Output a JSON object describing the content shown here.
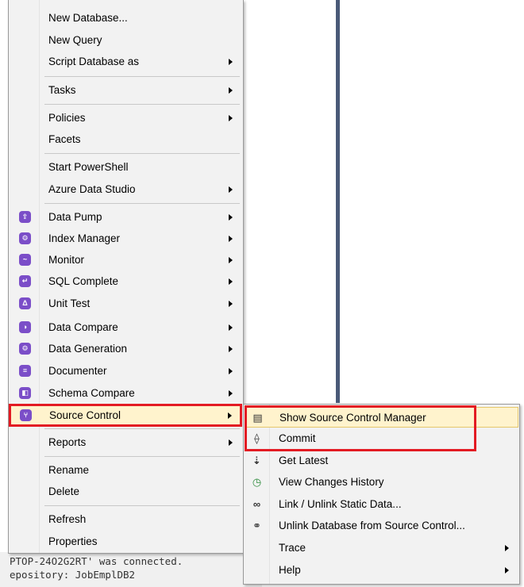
{
  "main_menu": {
    "items": [
      {
        "label": "New Database...",
        "arrow": false
      },
      {
        "label": "New Query",
        "arrow": false
      },
      {
        "label": "Script Database as",
        "arrow": true
      },
      {
        "label": "Tasks",
        "arrow": true
      },
      {
        "label": "Policies",
        "arrow": true
      },
      {
        "label": "Facets",
        "arrow": false
      },
      {
        "label": "Start PowerShell",
        "arrow": false
      },
      {
        "label": "Azure Data Studio",
        "arrow": true
      },
      {
        "label": "Data Pump",
        "arrow": true,
        "icon": "data-pump-icon"
      },
      {
        "label": "Index Manager",
        "arrow": true,
        "icon": "index-manager-icon"
      },
      {
        "label": "Monitor",
        "arrow": true,
        "icon": "monitor-icon"
      },
      {
        "label": "SQL Complete",
        "arrow": true,
        "icon": "sql-complete-icon"
      },
      {
        "label": "Unit Test",
        "arrow": true,
        "icon": "unit-test-icon"
      },
      {
        "label": "Data Compare",
        "arrow": true,
        "icon": "data-compare-icon"
      },
      {
        "label": "Data Generation",
        "arrow": true,
        "icon": "data-generation-icon"
      },
      {
        "label": "Documenter",
        "arrow": true,
        "icon": "documenter-icon"
      },
      {
        "label": "Schema Compare",
        "arrow": true,
        "icon": "schema-compare-icon"
      },
      {
        "label": "Source Control",
        "arrow": true,
        "icon": "source-control-icon",
        "highlighted": true
      },
      {
        "label": "Reports",
        "arrow": true
      },
      {
        "label": "Rename",
        "arrow": false
      },
      {
        "label": "Delete",
        "arrow": false
      },
      {
        "label": "Refresh",
        "arrow": false
      },
      {
        "label": "Properties",
        "arrow": false
      }
    ]
  },
  "sub_menu": {
    "items": [
      {
        "label": "Show Source Control Manager",
        "arrow": false,
        "icon": "source-control-manager-icon",
        "highlighted": true
      },
      {
        "label": "Commit",
        "arrow": false,
        "icon": "commit-icon"
      },
      {
        "label": "Get Latest",
        "arrow": false,
        "icon": "get-latest-icon"
      },
      {
        "label": "View Changes History",
        "arrow": false,
        "icon": "history-icon"
      },
      {
        "label": "Link / Unlink Static Data...",
        "arrow": false,
        "icon": "link-icon"
      },
      {
        "label": "Unlink Database from Source Control...",
        "arrow": false,
        "icon": "unlink-icon"
      },
      {
        "label": "Trace",
        "arrow": true
      },
      {
        "label": "Help",
        "arrow": true
      }
    ]
  },
  "status": {
    "line1": "PTOP-24O2G2RT' was connected.",
    "line2": "epository: JobEmplDB2"
  },
  "colors": {
    "accent_icon": "#7b4ec8",
    "highlight": "#fff3cd",
    "annotation_red": "#e31b23"
  }
}
